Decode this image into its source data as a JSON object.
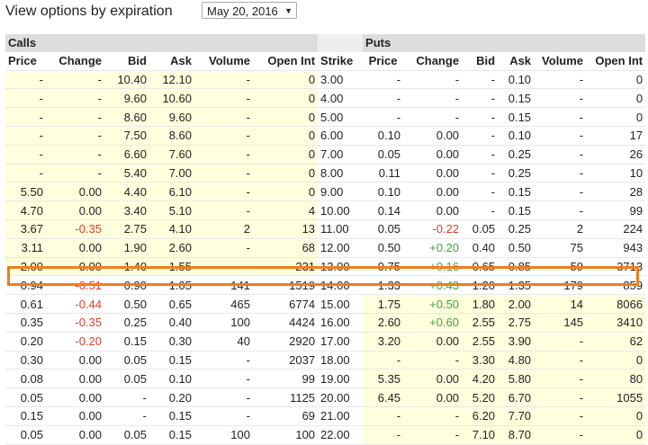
{
  "header": {
    "label": "View options by expiration",
    "expiration_selected": "May 20, 2016"
  },
  "groups": {
    "calls": "Calls",
    "puts": "Puts"
  },
  "columns": [
    "Price",
    "Change",
    "Bid",
    "Ask",
    "Volume",
    "Open Int",
    "Strike",
    "Price",
    "Change",
    "Bid",
    "Ask",
    "Volume",
    "Open Int"
  ],
  "rows": [
    {
      "c": [
        "-",
        "-",
        "10.40",
        "12.10",
        "-",
        "0"
      ],
      "s": "3.00",
      "p": [
        "-",
        "-",
        "-",
        "0.10",
        "-",
        "0"
      ],
      "call_itm": true,
      "put_itm": false
    },
    {
      "c": [
        "-",
        "-",
        "9.60",
        "10.60",
        "-",
        "0"
      ],
      "s": "4.00",
      "p": [
        "-",
        "-",
        "-",
        "0.15",
        "-",
        "0"
      ],
      "call_itm": true,
      "put_itm": false
    },
    {
      "c": [
        "-",
        "-",
        "8.60",
        "9.60",
        "-",
        "0"
      ],
      "s": "5.00",
      "p": [
        "-",
        "-",
        "-",
        "0.15",
        "-",
        "0"
      ],
      "call_itm": true,
      "put_itm": false
    },
    {
      "c": [
        "-",
        "-",
        "7.50",
        "8.60",
        "-",
        "0"
      ],
      "s": "6.00",
      "p": [
        "0.10",
        "0.00",
        "-",
        "0.10",
        "-",
        "17"
      ],
      "call_itm": true,
      "put_itm": false
    },
    {
      "c": [
        "-",
        "-",
        "6.60",
        "7.60",
        "-",
        "0"
      ],
      "s": "7.00",
      "p": [
        "0.05",
        "0.00",
        "-",
        "0.25",
        "-",
        "26"
      ],
      "call_itm": true,
      "put_itm": false
    },
    {
      "c": [
        "-",
        "-",
        "5.40",
        "7.00",
        "-",
        "0"
      ],
      "s": "8.00",
      "p": [
        "0.11",
        "0.00",
        "-",
        "0.25",
        "-",
        "10"
      ],
      "call_itm": true,
      "put_itm": false
    },
    {
      "c": [
        "5.50",
        "0.00",
        "4.40",
        "6.10",
        "-",
        "0"
      ],
      "s": "9.00",
      "p": [
        "0.10",
        "0.00",
        "-",
        "0.15",
        "-",
        "28"
      ],
      "call_itm": true,
      "put_itm": false
    },
    {
      "c": [
        "4.70",
        "0.00",
        "3.40",
        "5.10",
        "-",
        "4"
      ],
      "s": "10.00",
      "p": [
        "0.14",
        "0.00",
        "-",
        "0.15",
        "-",
        "99"
      ],
      "call_itm": true,
      "put_itm": false
    },
    {
      "c": [
        "3.67",
        "-0.35",
        "2.75",
        "4.10",
        "2",
        "13"
      ],
      "s": "11.00",
      "p": [
        "0.05",
        "-0.22",
        "0.05",
        "0.25",
        "2",
        "224"
      ],
      "call_itm": true,
      "put_itm": false
    },
    {
      "c": [
        "3.11",
        "0.00",
        "1.90",
        "2.60",
        "-",
        "68"
      ],
      "s": "12.00",
      "p": [
        "0.50",
        "+0.20",
        "0.40",
        "0.50",
        "75",
        "943"
      ],
      "call_itm": true,
      "put_itm": false
    },
    {
      "c": [
        "2.00",
        "0.00",
        "1.40",
        "1.55",
        "-",
        "231"
      ],
      "s": "13.00",
      "p": [
        "0.75",
        "+0.16",
        "0.65",
        "0.85",
        "59",
        "3713"
      ],
      "call_itm": true,
      "put_itm": false
    },
    {
      "c": [
        "0.94",
        "-0.51",
        "0.90",
        "1.05",
        "141",
        "1519"
      ],
      "s": "14.00",
      "p": [
        "1.33",
        "+0.43",
        "1.20",
        "1.35",
        "179",
        "859"
      ],
      "call_itm": false,
      "put_itm": false,
      "highlight": true
    },
    {
      "c": [
        "0.61",
        "-0.44",
        "0.50",
        "0.65",
        "465",
        "6774"
      ],
      "s": "15.00",
      "p": [
        "1.75",
        "+0.50",
        "1.80",
        "2.00",
        "14",
        "8066"
      ],
      "call_itm": false,
      "put_itm": true
    },
    {
      "c": [
        "0.35",
        "-0.35",
        "0.25",
        "0.40",
        "100",
        "4424"
      ],
      "s": "16.00",
      "p": [
        "2.60",
        "+0.60",
        "2.55",
        "2.75",
        "145",
        "3410"
      ],
      "call_itm": false,
      "put_itm": true
    },
    {
      "c": [
        "0.20",
        "-0.20",
        "0.15",
        "0.30",
        "40",
        "2920"
      ],
      "s": "17.00",
      "p": [
        "3.20",
        "0.00",
        "2.55",
        "3.90",
        "-",
        "62"
      ],
      "call_itm": false,
      "put_itm": true
    },
    {
      "c": [
        "0.30",
        "0.00",
        "0.05",
        "0.15",
        "-",
        "2037"
      ],
      "s": "18.00",
      "p": [
        "-",
        "-",
        "3.30",
        "4.80",
        "-",
        "0"
      ],
      "call_itm": false,
      "put_itm": true
    },
    {
      "c": [
        "0.08",
        "0.00",
        "0.05",
        "0.10",
        "-",
        "99"
      ],
      "s": "19.00",
      "p": [
        "5.35",
        "0.00",
        "4.20",
        "5.80",
        "-",
        "80"
      ],
      "call_itm": false,
      "put_itm": true
    },
    {
      "c": [
        "0.05",
        "0.00",
        "-",
        "0.20",
        "-",
        "1125"
      ],
      "s": "20.00",
      "p": [
        "6.45",
        "0.00",
        "5.20",
        "6.70",
        "-",
        "1055"
      ],
      "call_itm": false,
      "put_itm": true
    },
    {
      "c": [
        "0.15",
        "0.00",
        "-",
        "0.15",
        "-",
        "69"
      ],
      "s": "21.00",
      "p": [
        "-",
        "-",
        "6.20",
        "7.70",
        "-",
        "0"
      ],
      "call_itm": false,
      "put_itm": true
    },
    {
      "c": [
        "0.05",
        "0.00",
        "0.05",
        "0.15",
        "100",
        "100"
      ],
      "s": "22.00",
      "p": [
        "-",
        "-",
        "7.10",
        "8.70",
        "-",
        "0"
      ],
      "call_itm": false,
      "put_itm": true
    }
  ],
  "colors": {
    "itm_background": "#ffffdd",
    "highlight_border": "#f07d1a",
    "negative": "#e03b2b",
    "positive": "#3aa83a"
  }
}
